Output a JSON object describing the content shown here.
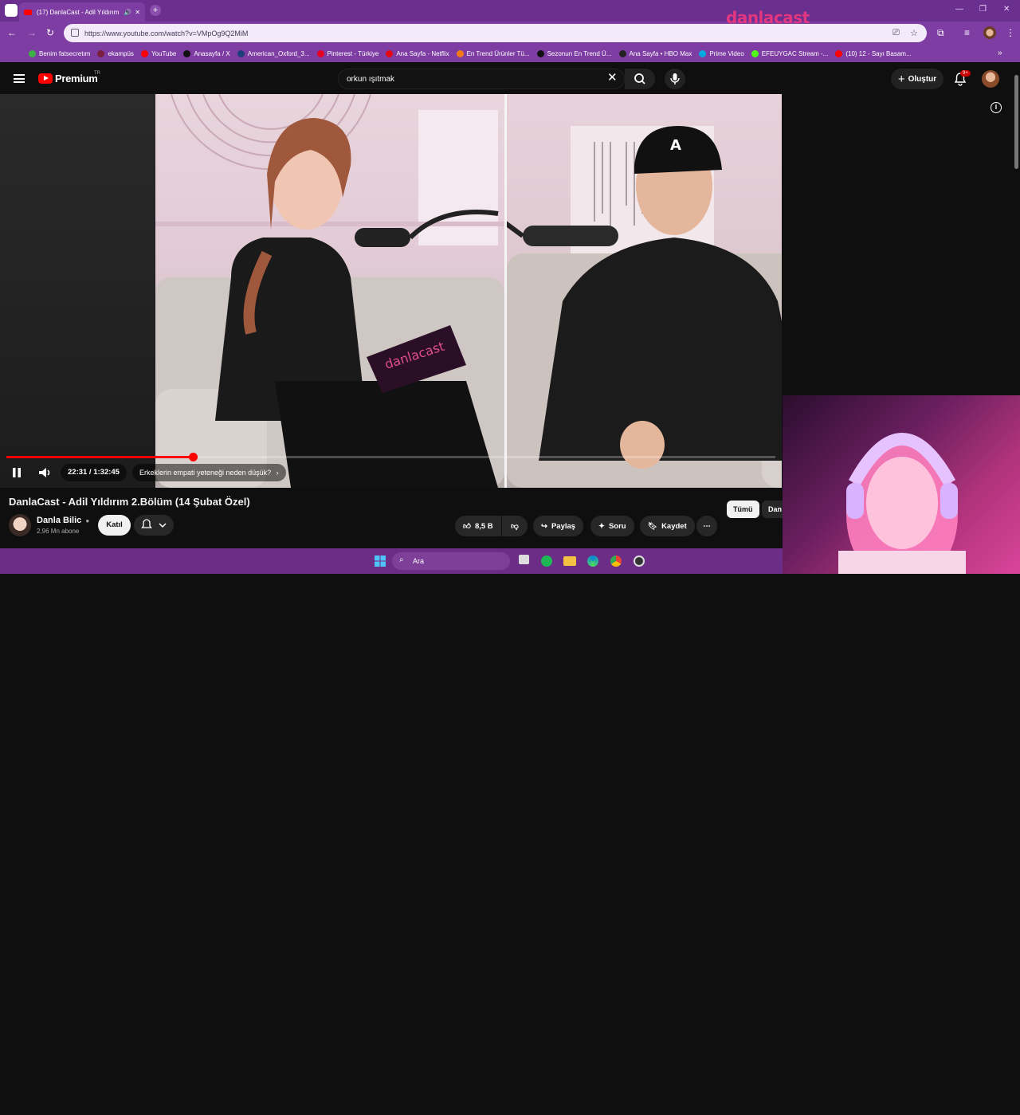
{
  "browser": {
    "tab": {
      "title": "(17) DanlaCast - Adil Yıldırım"
    },
    "url": "https://www.youtube.com/watch?v=VMpOg9Q2MiM",
    "bookmarks": [
      {
        "label": "Benim fatsecretım",
        "color": "#3cb043"
      },
      {
        "label": "ekampüs",
        "color": "#7a1f3d"
      },
      {
        "label": "YouTube",
        "color": "#ff0000"
      },
      {
        "label": "Anasayfa / X",
        "color": "#111111"
      },
      {
        "label": "American_Oxford_3...",
        "color": "#1f3f7a"
      },
      {
        "label": "Pinterest - Türkiye",
        "color": "#e60023"
      },
      {
        "label": "Ana Sayfa - Netflix",
        "color": "#e50914"
      },
      {
        "label": "En Trend Ürünler Tü...",
        "color": "#f27a1a"
      },
      {
        "label": "Sezonun En Trend Ü...",
        "color": "#111111"
      },
      {
        "label": "Ana Sayfa • HBO Max",
        "color": "#222222"
      },
      {
        "label": "Prime Video",
        "color": "#00a8e1"
      },
      {
        "label": "EFEUYGAC Stream -...",
        "color": "#53fc18"
      },
      {
        "label": "(10) 12 - Sayı Basam...",
        "color": "#ff0000"
      }
    ]
  },
  "youtube": {
    "brand": "Premium",
    "region": "TR",
    "search_query": "orkun ışıtmak",
    "create_label": "Oluştur",
    "notif_badge": "9+",
    "player": {
      "overlay_logo": "danlacast",
      "time": "22:31 / 1:32:45",
      "chapter": "Erkeklerin empati yeteneği neden düşük?",
      "progress": 0.243
    },
    "video": {
      "title": "DanlaCast - Adil Yıldırım 2.Bölüm (14 Şubat Özel)",
      "channel": "Danla Bilic",
      "subs": "2,96 Mn abone",
      "join": "Katıl",
      "likes": "8,5 B",
      "share": "Paylaş",
      "ask": "Soru",
      "save": "Kaydet"
    },
    "chips": [
      "Tümü",
      "Dan"
    ]
  },
  "taskbar": {
    "search_placeholder": "Ara"
  },
  "colors": {
    "accent": "#ff0000",
    "browser_frame": "#7d3da2",
    "yt_bg": "#0f0f0f"
  }
}
